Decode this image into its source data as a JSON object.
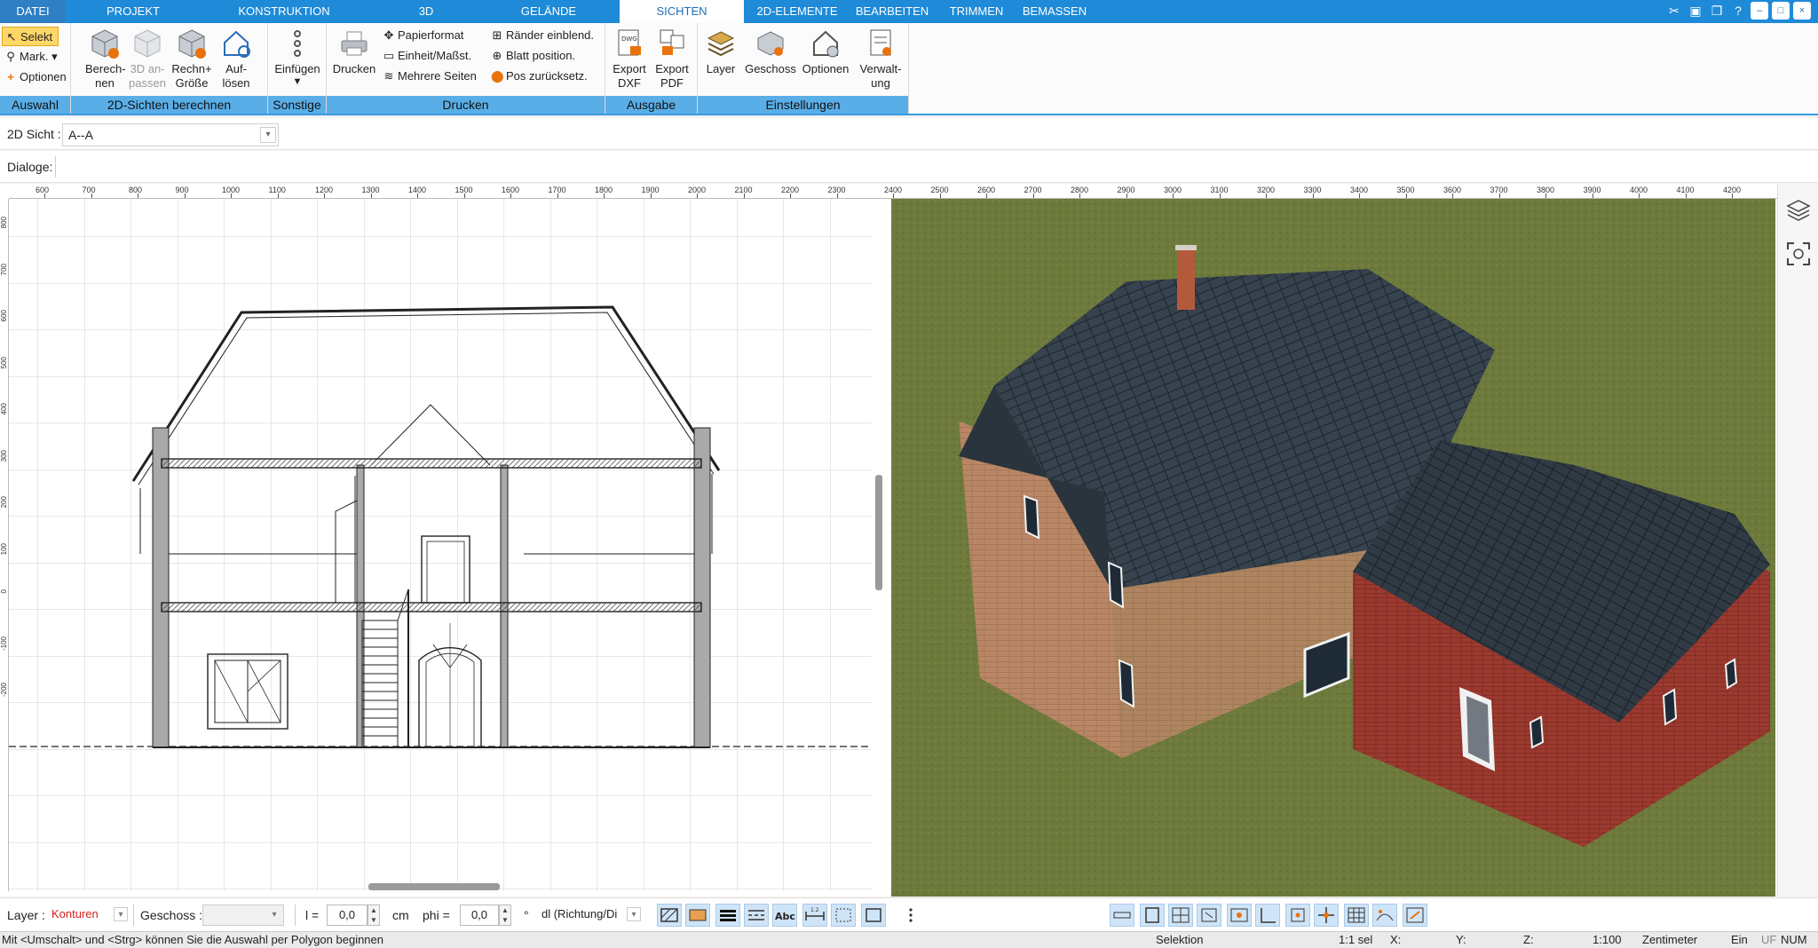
{
  "menu": {
    "tabs": [
      "DATEI",
      "PROJEKT",
      "KONSTRUKTION",
      "3D",
      "GELÄNDE",
      "SICHTEN",
      "2D-ELEMENTE",
      "BEARBEITEN",
      "TRIMMEN",
      "BEMASSEN"
    ],
    "active_tab": "SICHTEN"
  },
  "window_controls": [
    "tools-icon",
    "home-icon",
    "restore-icon",
    "help-icon",
    "minimize-icon",
    "maximize-icon",
    "close-icon"
  ],
  "ribbon": {
    "auswahl": {
      "title": "Auswahl",
      "selekt": "Selekt",
      "mark": "Mark.",
      "optionen": "Optionen"
    },
    "sichten2d": {
      "title": "2D-Sichten berechnen",
      "berechnen": "Berech-\nnen",
      "anpassen": "3D an-\npassen",
      "rechngroesse": "Rechn+\nGröße",
      "aufloesen": "Auf-\nlösen"
    },
    "sonstige": {
      "title": "Sonstige",
      "einfuegen": "Einfügen"
    },
    "drucken": {
      "title": "Drucken",
      "drucken": "Drucken",
      "papierformat": "Papierformat",
      "einheit": "Einheit/Maßst.",
      "mehrere": "Mehrere Seiten",
      "raender": "Ränder einblend.",
      "blatt": "Blatt position.",
      "pos": "Pos zurücksetz."
    },
    "ausgabe": {
      "title": "Ausgabe",
      "export_dxf": "Export\nDXF",
      "export_pdf": "Export\nPDF"
    },
    "einstellungen": {
      "title": "Einstellungen",
      "layer": "Layer",
      "geschoss": "Geschoss",
      "optionen": "Optionen",
      "verwaltung": "Verwalt-\nung"
    }
  },
  "view_row": {
    "label": "2D Sicht :",
    "value": "A--A"
  },
  "dialog_row": {
    "label": "Dialoge:"
  },
  "ruler_left": {
    "ticks": [
      "800",
      "700",
      "600",
      "500",
      "400",
      "300",
      "200",
      "100",
      "0",
      "-100",
      "-200"
    ]
  },
  "ruler_top_left": {
    "ticks": [
      "600",
      "700",
      "800",
      "900",
      "1000",
      "1100",
      "1200",
      "1300",
      "1400",
      "1500",
      "1600",
      "1700",
      "1800",
      "1900",
      "2000",
      "2100",
      "2200",
      "2300"
    ]
  },
  "ruler_top_right": {
    "ticks": [
      "2400",
      "2500",
      "2600",
      "2700",
      "2800",
      "2900",
      "3000",
      "3100",
      "3200",
      "3300",
      "3400",
      "3500",
      "3600",
      "3700",
      "3800",
      "3900",
      "4000",
      "4100",
      "4200"
    ]
  },
  "input_bar": {
    "layer_label": "Layer :",
    "layer_value": "Konturen",
    "layer_color": "#d0201a",
    "geschoss_label": "Geschoss :",
    "geschoss_value": "",
    "l_label": "l =",
    "l_value": "0,0",
    "l_unit": "cm",
    "phi_label": "phi =",
    "phi_value": "0,0",
    "phi_unit": "°",
    "dl_value": "dl (Richtung/Di"
  },
  "status": {
    "hint": "Mit <Umschalt> und <Strg> können Sie die Auswahl per Polygon beginnen",
    "mode": "Selektion",
    "sel": "1:1 sel",
    "x": "X:",
    "y": "Y:",
    "z": "Z:",
    "scale": "1:100",
    "unit": "Zentimeter",
    "ein": "Ein",
    "uf": "UF",
    "num": "NUM"
  }
}
